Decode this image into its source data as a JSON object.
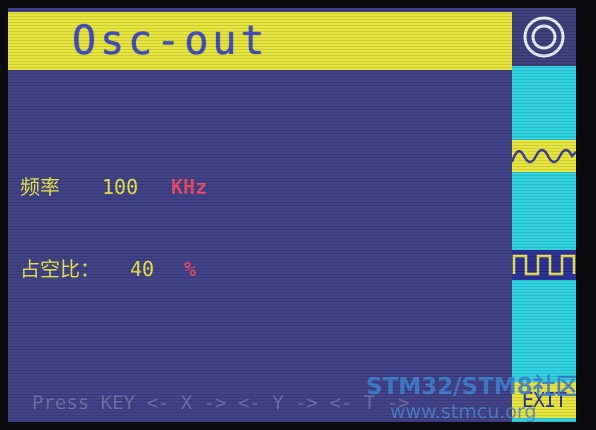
{
  "header": {
    "title": "Osc-out"
  },
  "frequency": {
    "label": "频率",
    "value": "100",
    "unit": "KHz"
  },
  "duty_cycle": {
    "label": "占空比：",
    "value": "40",
    "unit": "%"
  },
  "sidebar": {
    "buttons": [
      {
        "icon": "target-circle-icon"
      },
      {
        "icon": "sine-wave-icon"
      },
      {
        "icon": "square-wave-icon"
      },
      {
        "label": "EXIT"
      }
    ]
  },
  "footer": {
    "hint": "Press KEY <- X -> <- Y -> <- T ->"
  },
  "watermark": {
    "brand": "STM32/STM8社区",
    "url": "www.stmcu.org"
  },
  "colors": {
    "background": "#3e3f84",
    "title_bar": "#e6e33b",
    "title_text": "#3f4bc0",
    "label_text": "#e8e44a",
    "unit_text": "#e14a63",
    "sidebar": "#2ed0de"
  }
}
